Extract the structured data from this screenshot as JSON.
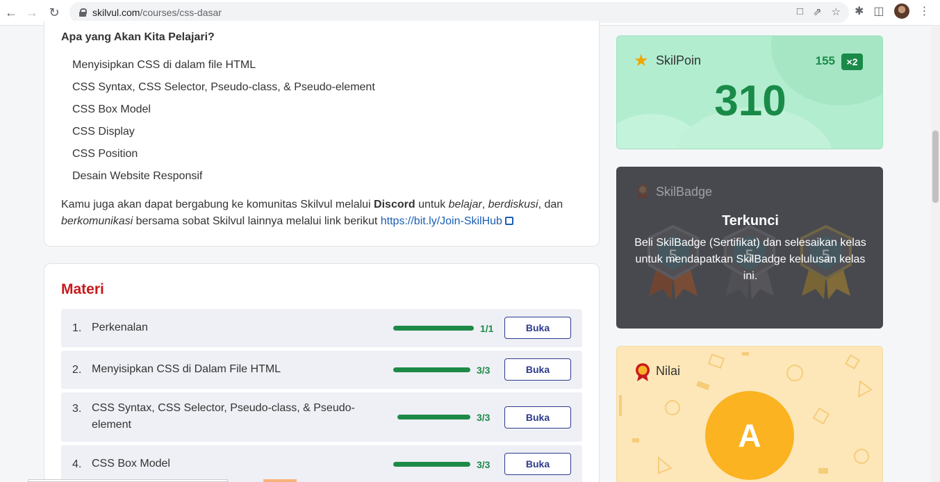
{
  "browser": {
    "url_host": "skilvul.com",
    "url_path": "/courses/css-dasar"
  },
  "about": {
    "title": "Apa yang Akan Kita Pelajari?",
    "topics": [
      "Menyisipkan CSS di dalam file HTML",
      "CSS Syntax, CSS Selector, Pseudo-class, & Pseudo-element",
      "CSS Box Model",
      "CSS Display",
      "CSS Position",
      "Desain Website Responsif"
    ],
    "text_1": "Kamu juga akan dapat bergabung ke komunitas Skilvul melalui ",
    "text_discord": "Discord",
    "text_2": " untuk ",
    "text_belajar": "belajar",
    "text_3": ", ",
    "text_berdiskusi": "berdiskusi",
    "text_4": ", dan ",
    "text_berkomunikasi": "berkomunikasi",
    "text_5": " bersama sobat Skilvul lainnya melalui link berikut ",
    "link": "https://bit.ly/Join-SkilHub"
  },
  "materi": {
    "title": "Materi",
    "lessons": [
      {
        "number": "1.",
        "name": "Perkenalan",
        "progress": "1/1",
        "fraction": 1.0,
        "button": "Buka"
      },
      {
        "number": "2.",
        "name": "Menyisipkan CSS di Dalam File HTML",
        "progress": "3/3",
        "fraction": 1.0,
        "button": "Buka"
      },
      {
        "number": "3.",
        "name": "CSS Syntax, CSS Selector, Pseudo-class, & Pseudo-element",
        "progress": "3/3",
        "fraction": 1.0,
        "button": "Buka"
      },
      {
        "number": "4.",
        "name": "CSS Box Model",
        "progress": "3/3",
        "fraction": 1.0,
        "button": "Buka"
      }
    ]
  },
  "skilpoin": {
    "title": "SkilPoin",
    "base": "155",
    "multiplier": "×2",
    "total": "310",
    "color": "#1a8a48"
  },
  "skilbadge": {
    "title": "SkilBadge",
    "lock_title": "Terkunci",
    "lock_text": "Beli SkilBadge (Sertifikat) dan selesaikan kelas untuk mendapatkan SkilBadge kelulusan kelas ini."
  },
  "nilai": {
    "title": "Nilai",
    "grade": "A"
  }
}
